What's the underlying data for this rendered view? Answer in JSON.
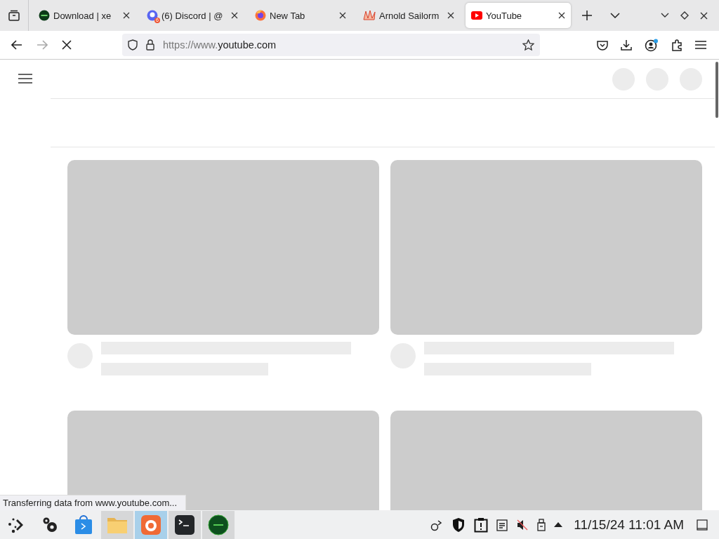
{
  "browser": {
    "tabs": [
      {
        "kind": "xemu",
        "title": "Download | xe",
        "selected": false
      },
      {
        "kind": "discord",
        "title": "(6) Discord | @",
        "badge": "6",
        "selected": false
      },
      {
        "kind": "firefox",
        "title": "New Tab",
        "selected": false
      },
      {
        "kind": "art",
        "title": "Arnold Sailorm",
        "selected": false
      },
      {
        "kind": "video",
        "title": "YouTube",
        "selected": true
      }
    ],
    "navigation": {
      "back_disabled": false,
      "forward_disabled": true,
      "loading": true
    },
    "address_bar": {
      "scheme": "https://www.",
      "domain": "youtube.com"
    },
    "account_notification": true,
    "page": {
      "cards": [
        {
          "kind": "video"
        },
        {
          "kind": "video"
        },
        {
          "kind": "thumbnail"
        },
        {
          "kind": "thumbnail"
        }
      ]
    },
    "status": "Transferring data from www.youtube.com..."
  },
  "taskbar": {
    "apps": [
      {
        "kind": "launcher",
        "running": false,
        "active": false
      },
      {
        "kind": "settings",
        "running": false,
        "active": false
      },
      {
        "kind": "store",
        "running": false,
        "active": false
      },
      {
        "kind": "files",
        "running": true,
        "active": false
      },
      {
        "kind": "firefox",
        "running": true,
        "active": true
      },
      {
        "kind": "terminal",
        "running": true,
        "active": false
      },
      {
        "kind": "xemu",
        "running": true,
        "active": false
      }
    ],
    "clock": "11/15/24 11:01 AM"
  }
}
